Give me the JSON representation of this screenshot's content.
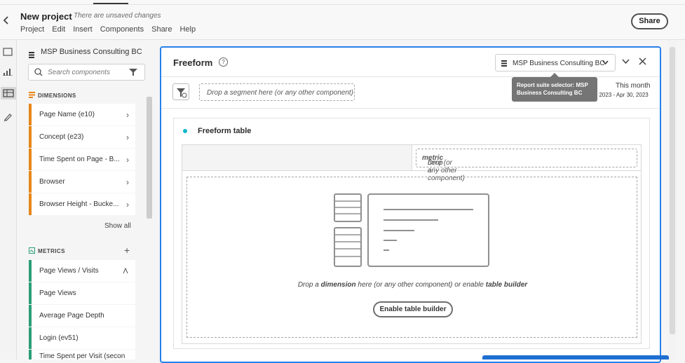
{
  "header": {
    "title": "New project",
    "unsaved": "There are unsaved changes",
    "menu": [
      "Project",
      "Edit",
      "Insert",
      "Components",
      "Share",
      "Help"
    ],
    "share_label": "Share"
  },
  "panel": {
    "report_suite": "MSP Business Consulting BC",
    "search_placeholder": "Search components",
    "dimensions_label": "DIMENSIONS",
    "dimensions": [
      "Page Name (e10)",
      "Concept (e23)",
      "Time Spent on Page - B...",
      "Browser",
      "Browser Height - Bucke..."
    ],
    "show_all": "Show all",
    "metrics_label": "METRICS",
    "metrics": [
      "Page Views / Visits",
      "Page Views",
      "Average Page Depth",
      "Login (ev51)",
      "Time Spent per Visit (secon"
    ]
  },
  "freeform": {
    "title": "Freeform",
    "report_suite": "MSP Business Consulting BC",
    "tooltip": "Report suite selector: MSP Business Consulting BC",
    "segment_drop": "Drop a segment here (or any other component)",
    "date_label": "This month",
    "date_range": ", 2023 - Apr 30, 2023",
    "table_title": "Freeform table",
    "metric_drop_pre": "Drop a ",
    "metric_drop_bold": "metric",
    "metric_drop_post": " here (or any other component)",
    "dim_drop_pre": "Drop a ",
    "dim_drop_bold": "dimension",
    "dim_drop_mid": " here (or any other component) or enable ",
    "dim_drop_bold2": "table builder",
    "enable_label": "Enable table builder"
  },
  "colors": {
    "accent": "#2680eb",
    "dimension": "#e68619",
    "metric": "#2d9d78",
    "viz_dot": "#12b5cb"
  }
}
